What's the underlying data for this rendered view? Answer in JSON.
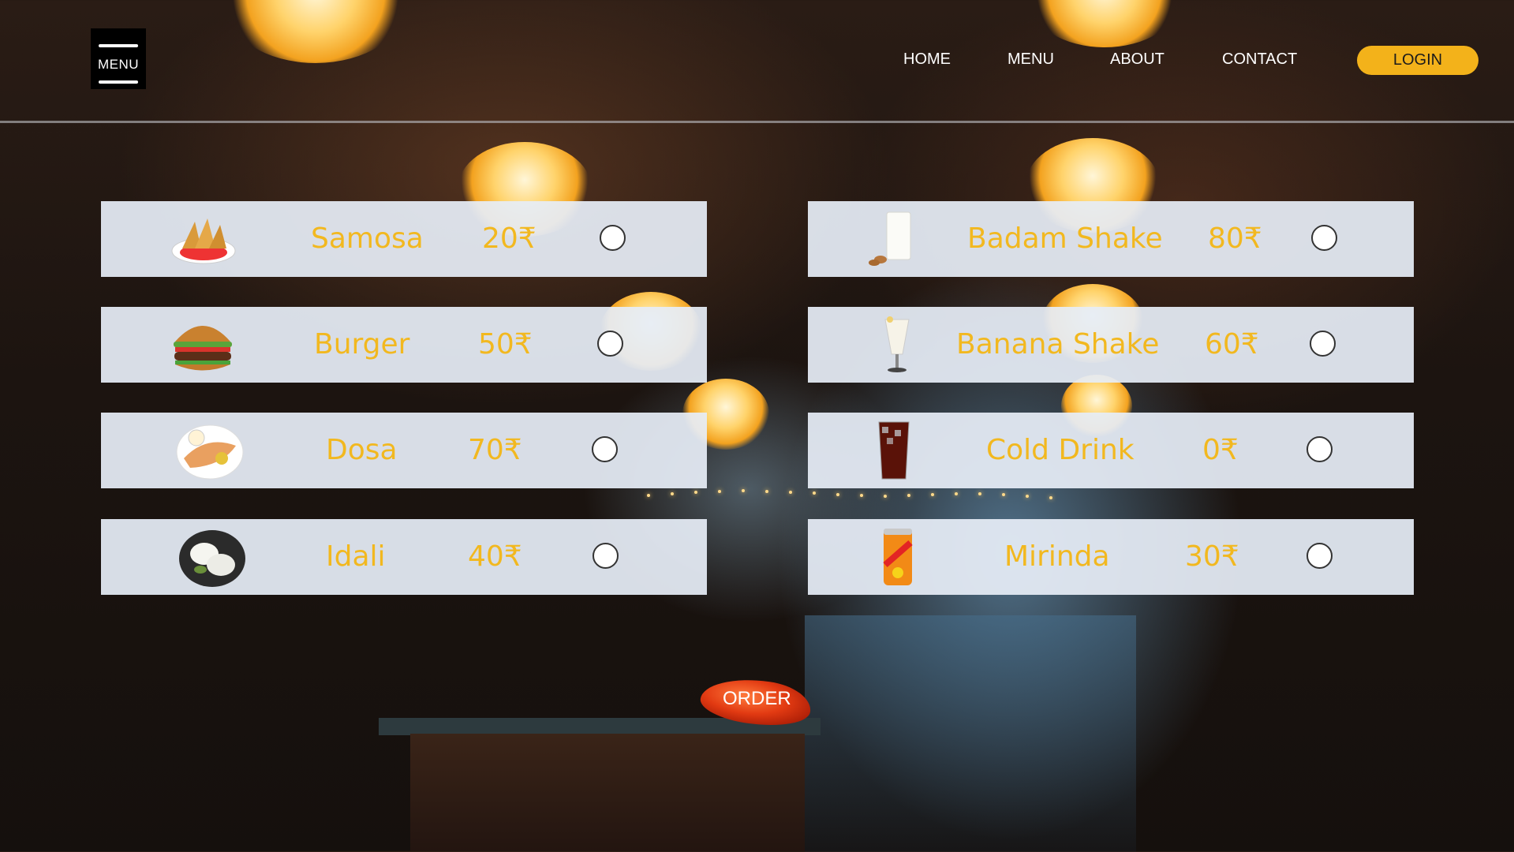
{
  "header": {
    "menu_toggle_label": "MENU",
    "nav": [
      {
        "label": "HOME"
      },
      {
        "label": "MENU"
      },
      {
        "label": "ABOUT"
      },
      {
        "label": "CONTACT"
      }
    ],
    "login_label": "LOGIN"
  },
  "menu": {
    "left": [
      {
        "name": "Samosa",
        "price": "20₹",
        "icon": "samosa-icon",
        "selected": false
      },
      {
        "name": "Burger",
        "price": "50₹",
        "icon": "burger-icon",
        "selected": false
      },
      {
        "name": "Dosa",
        "price": "70₹",
        "icon": "dosa-icon",
        "selected": false
      },
      {
        "name": "Idali",
        "price": "40₹",
        "icon": "idli-icon",
        "selected": false
      }
    ],
    "right": [
      {
        "name": "Badam Shake",
        "price": "80₹",
        "icon": "milk-glass-icon",
        "selected": false
      },
      {
        "name": "Banana Shake",
        "price": "60₹",
        "icon": "shake-glass-icon",
        "selected": false
      },
      {
        "name": "Cold Drink",
        "price": "0₹",
        "icon": "cola-glass-icon",
        "selected": false
      },
      {
        "name": "Mirinda",
        "price": "30₹",
        "icon": "soda-can-icon",
        "selected": false
      }
    ]
  },
  "order_label": "ORDER",
  "colors": {
    "accent": "#f3b21a",
    "item_text": "#f2b81f",
    "card_bg": "#e6edf6",
    "order_button": "#e23a12"
  }
}
